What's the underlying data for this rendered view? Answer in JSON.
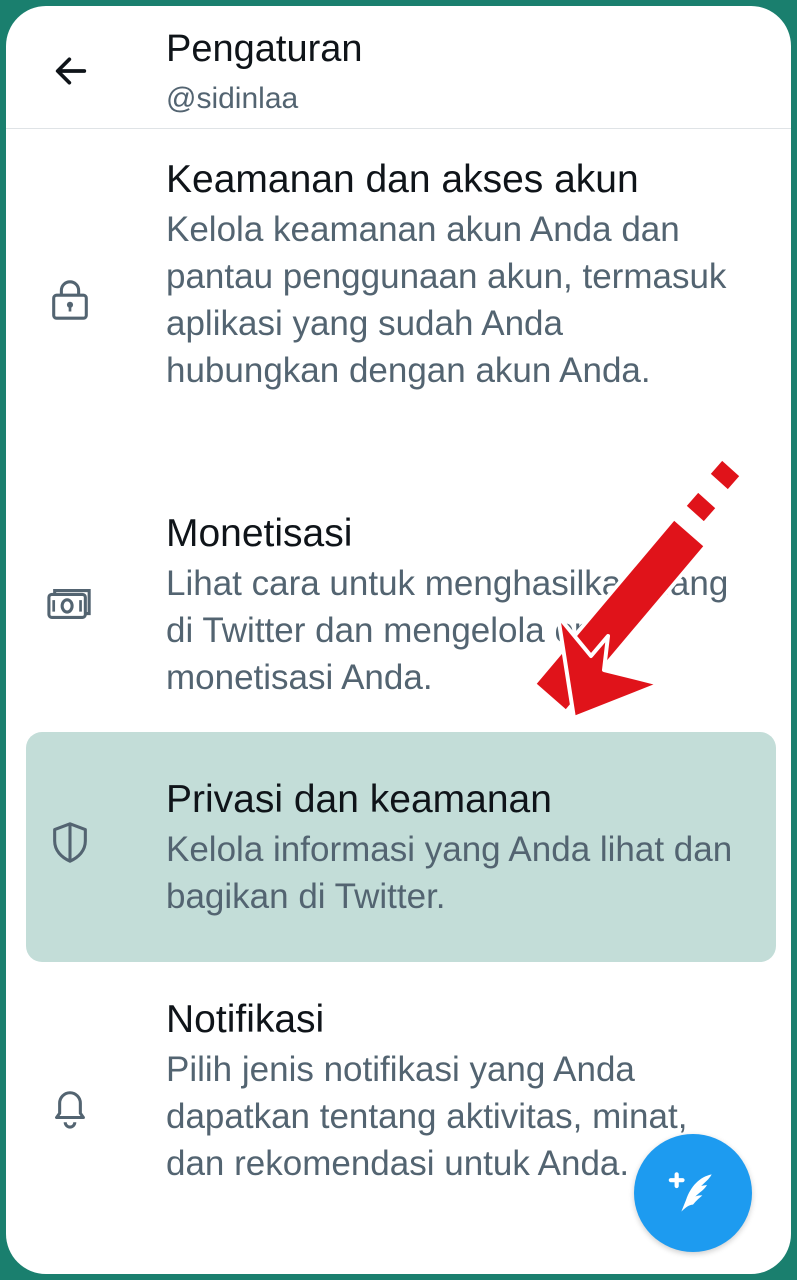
{
  "header": {
    "title": "Pengaturan",
    "handle": "@sidinlaa",
    "back_icon": "arrow-left-icon"
  },
  "settings": [
    {
      "icon": "lock-icon",
      "title": "Keamanan dan akses akun",
      "description": "Kelola keamanan akun Anda dan pantau penggunaan akun, termasuk aplikasi yang sudah Anda hubungkan dengan akun Anda."
    },
    {
      "icon": "money-icon",
      "title": "Monetisasi",
      "description": "Lihat cara untuk menghasilkan uang di Twitter dan mengelola opsi monetisasi Anda."
    },
    {
      "icon": "shield-icon",
      "title": "Privasi dan keamanan",
      "description": "Kelola informasi yang Anda lihat dan bagikan di Twitter.",
      "highlighted": true
    },
    {
      "icon": "bell-icon",
      "title": "Notifikasi",
      "description": "Pilih jenis notifikasi yang Anda dapatkan tentang aktivitas, minat, dan rekomendasi untuk Anda."
    }
  ],
  "fab": {
    "icon": "compose-tweet-icon"
  },
  "colors": {
    "accent": "#1d9bf0",
    "highlight": "#c3ddd8",
    "frame": "#1a7f6e",
    "arrow": "#e0131a"
  }
}
